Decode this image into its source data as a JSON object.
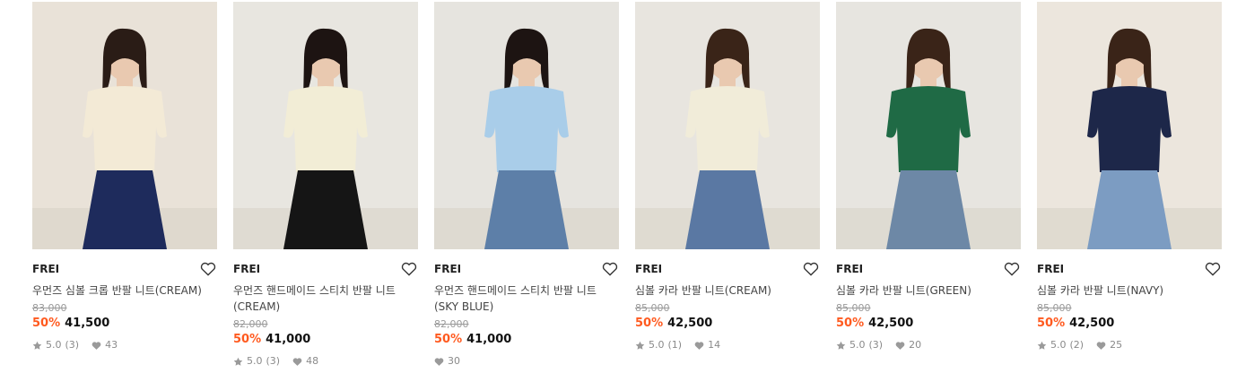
{
  "products": [
    {
      "brand": "FREI",
      "title": "우먼즈 심볼 크롭 반팔 니트(CREAM)",
      "original_price": "83,000",
      "discount": "50%",
      "price": "41,500",
      "rating": "5.0",
      "reviews": "(3)",
      "likes": "43",
      "colors": {
        "bg": "#e9e2d8",
        "top": "#f3ead6",
        "bottom": "#1e2b5c",
        "hair": "#2a1c16"
      }
    },
    {
      "brand": "FREI",
      "title": "우먼즈 핸드메이드 스티치 반팔 니트(CREAM)",
      "original_price": "82,000",
      "discount": "50%",
      "price": "41,000",
      "rating": "5.0",
      "reviews": "(3)",
      "likes": "48",
      "colors": {
        "bg": "#e8e6e0",
        "top": "#f2edd6",
        "bottom": "#151515",
        "hair": "#1d1412"
      }
    },
    {
      "brand": "FREI",
      "title": "우먼즈 핸드메이드 스티치 반팔 니트(SKY BLUE)",
      "original_price": "82,000",
      "discount": "50%",
      "price": "41,000",
      "rating": "",
      "reviews": "",
      "likes": "30",
      "colors": {
        "bg": "#e6e4df",
        "top": "#a9cde9",
        "bottom": "#5d7fa8",
        "hair": "#1d1412"
      }
    },
    {
      "brand": "FREI",
      "title": "심볼 카라 반팔 니트(CREAM)",
      "original_price": "85,000",
      "discount": "50%",
      "price": "42,500",
      "rating": "5.0",
      "reviews": "(1)",
      "likes": "14",
      "colors": {
        "bg": "#e8e5df",
        "top": "#f1ecd9",
        "bottom": "#5a78a3",
        "hair": "#3a2418"
      }
    },
    {
      "brand": "FREI",
      "title": "심볼 카라 반팔 니트(GREEN)",
      "original_price": "85,000",
      "discount": "50%",
      "price": "42,500",
      "rating": "5.0",
      "reviews": "(3)",
      "likes": "20",
      "colors": {
        "bg": "#e7e5e0",
        "top": "#1f6a45",
        "bottom": "#6d88a6",
        "hair": "#3a2418"
      }
    },
    {
      "brand": "FREI",
      "title": "심볼 카라 반팔 니트(NAVY)",
      "original_price": "85,000",
      "discount": "50%",
      "price": "42,500",
      "rating": "5.0",
      "reviews": "(2)",
      "likes": "25",
      "colors": {
        "bg": "#ece6dd",
        "top": "#1d2749",
        "bottom": "#7c9cc2",
        "hair": "#3a2418"
      }
    }
  ]
}
